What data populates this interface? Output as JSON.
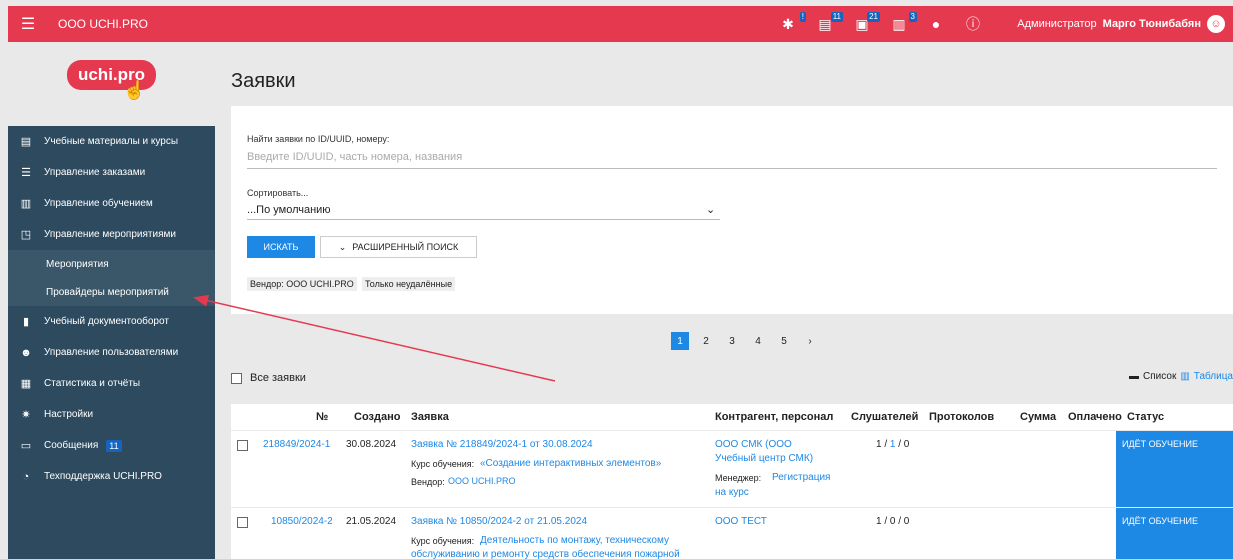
{
  "topbar": {
    "org": "ООО UCHI.PRO",
    "badges": [
      "!",
      "11",
      "21",
      "3"
    ],
    "role": "Администратор",
    "user": "Марго Тюнибабян"
  },
  "logo": {
    "text": "uchi.pro"
  },
  "sidebar": {
    "items": [
      {
        "label": "Учебные материалы и курсы",
        "icon": "book-icon"
      },
      {
        "label": "Управление заказами",
        "icon": "list-icon"
      },
      {
        "label": "Управление обучением",
        "icon": "document-icon"
      },
      {
        "label": "Управление мероприятиями",
        "icon": "cast-icon"
      }
    ],
    "sub": [
      "Мероприятия",
      "Провайдеры мероприятий"
    ],
    "items2": [
      {
        "label": "Учебный документооборот",
        "icon": "file-icon"
      },
      {
        "label": "Управление пользователями",
        "icon": "users-icon"
      },
      {
        "label": "Статистика и отчёты",
        "icon": "chart-icon"
      },
      {
        "label": "Настройки",
        "icon": "gear-icon"
      },
      {
        "label": "Сообщения",
        "icon": "message-icon",
        "badge": "11"
      },
      {
        "label": "Техподдержка UCHI.PRO",
        "icon": "support-icon"
      }
    ]
  },
  "page": {
    "title": "Заявки"
  },
  "search": {
    "label": "Найти заявки по ID/UUID, номеру:",
    "placeholder": "Введите ID/UUID, часть номера, названия",
    "sort_label": "Сортировать...",
    "sort_value": "...По умолчанию",
    "btn_search": "ИСКАТЬ",
    "btn_advanced": "РАСШИРЕННЫЙ ПОИСК",
    "chips": [
      "Вендор: ООО UCHI.PRO",
      "Только неудалённые"
    ]
  },
  "pager": {
    "pages": [
      "1",
      "2",
      "3",
      "4",
      "5"
    ],
    "active": "1",
    "next": "›"
  },
  "list": {
    "all_label": "Все заявки",
    "view_list": "Список",
    "view_table": "Таблица"
  },
  "table": {
    "headers": [
      "№",
      "Создано",
      "Заявка",
      "Контрагент, персонал",
      "Слушателей",
      "Протоколов",
      "Сумма",
      "Оплачено",
      "Статус"
    ],
    "rows": [
      {
        "num": "218849/2024-1",
        "created": "30.08.2024",
        "title": "Заявка № 218849/2024-1 от 30.08.2024",
        "course_label": "Курс обучения:",
        "course": "«Создание интерактивных элементов»",
        "vendor_label": "Вендор:",
        "vendor": "ООО UCHI.PRO",
        "contragent_1": "ООО СМК (ООО",
        "contragent_2": "Учебный центр СМК)",
        "manager_label": "Менеджер:",
        "manager_1": "Регистрация",
        "manager_2": "на курс",
        "listeners_a": "1 / ",
        "listeners_b": "1",
        "listeners_c": " / 0",
        "status": "ИДЁТ ОБУЧЕНИЕ"
      },
      {
        "num": "10850/2024-2",
        "created": "21.05.2024",
        "title": "Заявка № 10850/2024-2 от 21.05.2024",
        "course_label": "Курс обучения:",
        "course_1": "Деятельность по монтажу, техническому",
        "course_2": "обслуживанию и ремонту средств обеспечения пожарной",
        "contragent_1": "ООО ТЕСТ",
        "listeners": "1 / 0 / 0",
        "status": "ИДЁТ ОБУЧЕНИЕ"
      }
    ]
  },
  "colors": {
    "brand": "#e53950",
    "sidebar": "#2d4a5f",
    "accent": "#1e88e5",
    "arrow": "#e53950"
  }
}
